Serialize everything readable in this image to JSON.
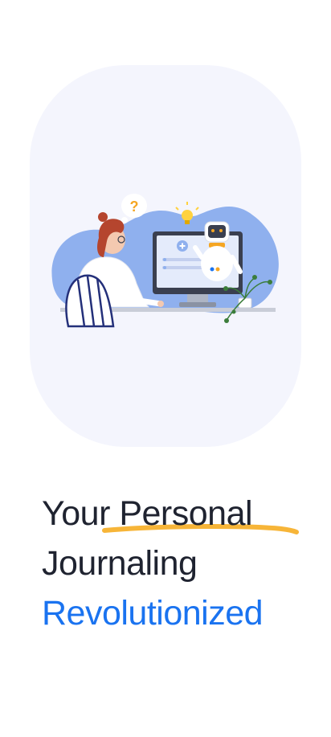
{
  "headline": {
    "line1": "Your Personal",
    "line2": "Journaling",
    "line3": "Revolutionized"
  },
  "colors": {
    "card_bg": "#f4f5fd",
    "blob": "#8fb0ee",
    "heading_dark": "#1f2330",
    "accent_blue": "#1a73f0",
    "underline_orange": "#f7b538"
  },
  "illustration": {
    "thought_bubble_symbol": "?"
  }
}
